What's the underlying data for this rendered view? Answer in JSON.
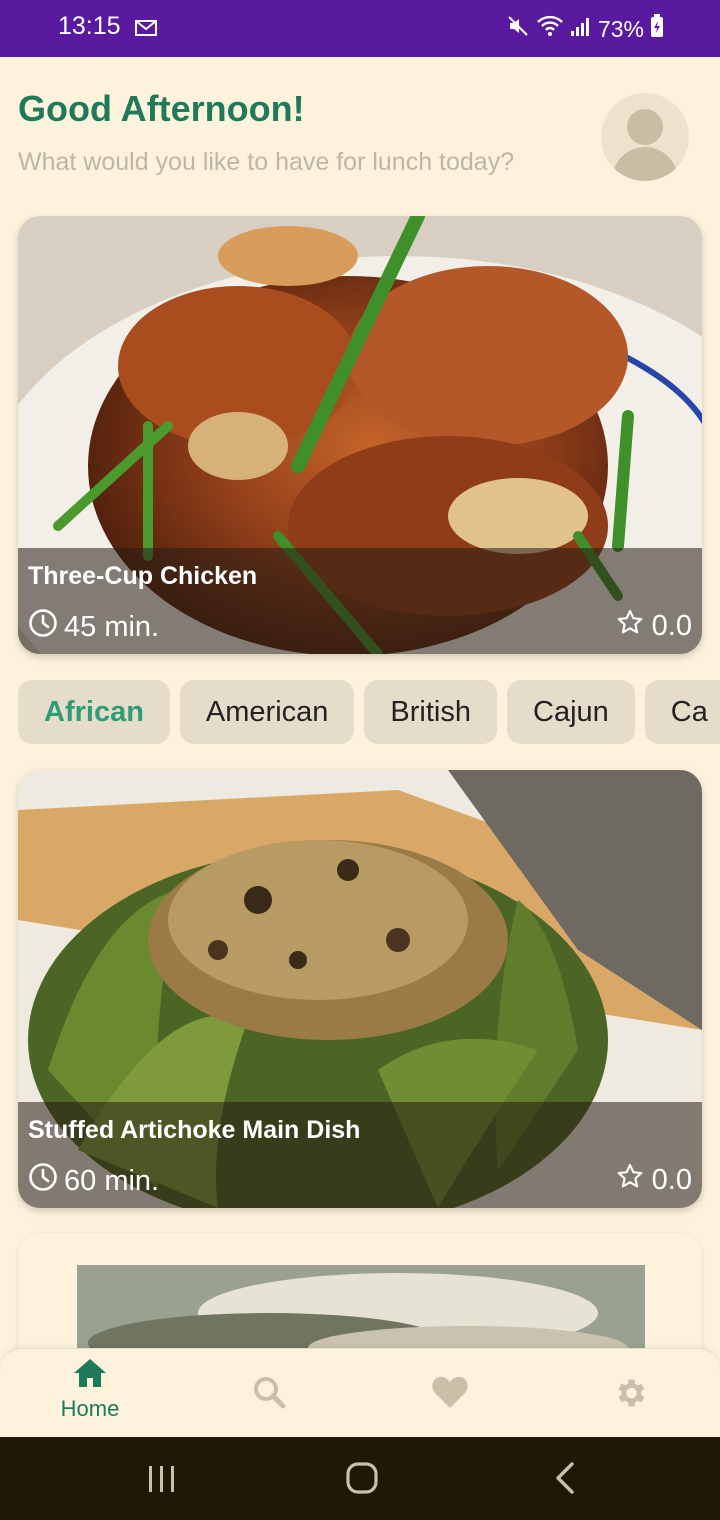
{
  "status": {
    "time": "13:15",
    "battery": "73%"
  },
  "header": {
    "greeting": "Good Afternoon!",
    "subtitle": "What would you like to have for lunch today?"
  },
  "featured": {
    "title": "Three-Cup Chicken",
    "time": "45 min.",
    "rating": "0.0"
  },
  "categories": [
    "African",
    "American",
    "British",
    "Cajun",
    "Ca"
  ],
  "recipes": [
    {
      "title": "Stuffed Artichoke Main Dish",
      "time": "60 min.",
      "rating": "0.0"
    }
  ],
  "nav": {
    "home_label": "Home",
    "active_color": "#1f7a5a",
    "inactive_color": "#cbbfa8"
  },
  "colors": {
    "status_bar": "#5a1aa0",
    "accent": "#1f7a5a",
    "chip_active_text": "#2e9c76",
    "background": "#fdf3dc"
  }
}
